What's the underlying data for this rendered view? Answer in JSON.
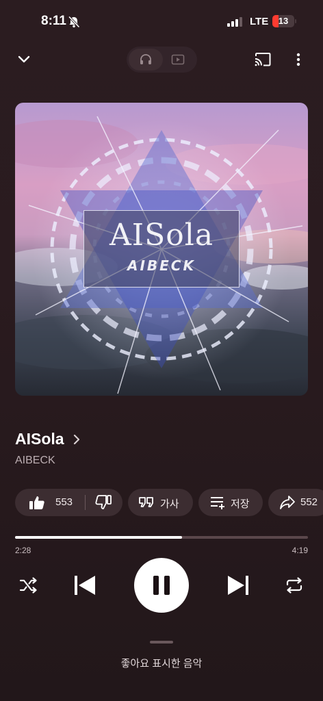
{
  "status_bar": {
    "time": "8:11",
    "network": "LTE",
    "battery": "13",
    "battery_level": 0.13,
    "battery_color": "#ff3b30"
  },
  "top_bar": {
    "icons": [
      "chevron-down-icon",
      "headphones-icon",
      "video-icon",
      "cast-icon",
      "more-vertical-icon"
    ],
    "mode_selected": "audio"
  },
  "album_art": {
    "title": "AISola",
    "artist": "AIBECK"
  },
  "track": {
    "title": "AISola",
    "artist": "AIBECK"
  },
  "actions": {
    "like_count": "553",
    "lyrics_label": "가사",
    "save_label": "저장",
    "share_count": "552"
  },
  "playback": {
    "elapsed": "2:28",
    "duration": "4:19",
    "progress": 0.57,
    "state": "playing"
  },
  "bottom": {
    "label": "좋아요 표시한 음악"
  },
  "colors": {
    "background": "#2b1c20",
    "chip": "#3c2d31",
    "accent": "#ffffff",
    "battery_low": "#ff3b30"
  }
}
